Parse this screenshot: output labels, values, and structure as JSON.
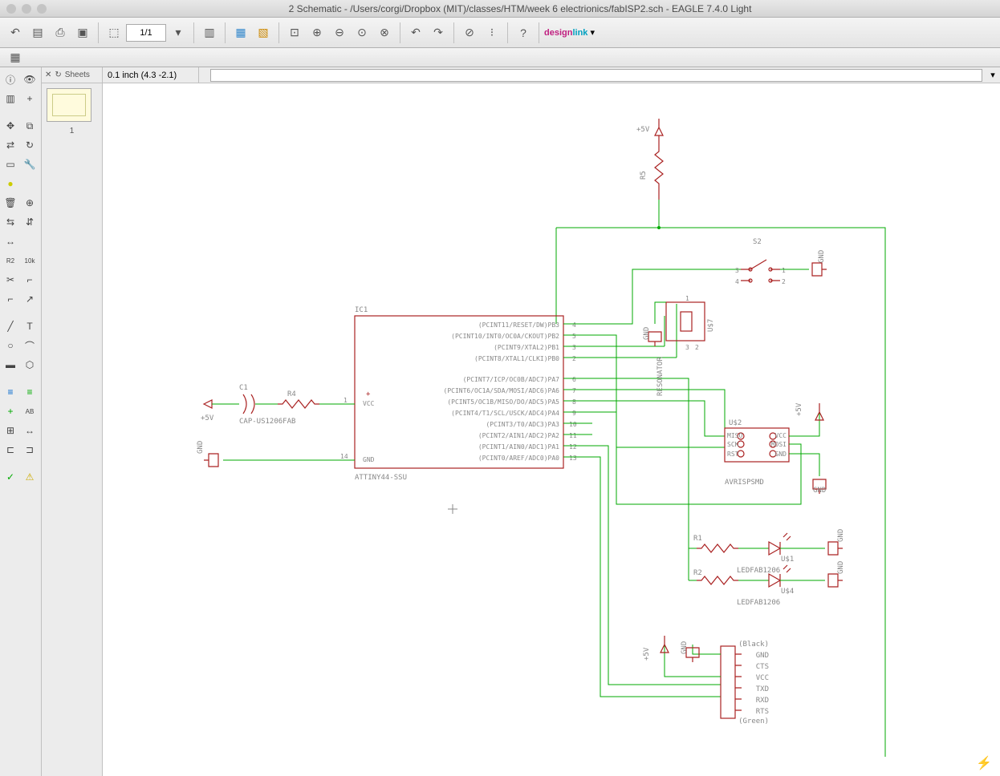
{
  "window": {
    "title": "2 Schematic - /Users/corgi/Dropbox (MIT)/classes/HTM/week 6 electrionics/fabISP2.sch - EAGLE 7.4.0 Light"
  },
  "toolbar": {
    "zoom": "1/1",
    "designlink_a": "design",
    "designlink_b": "link"
  },
  "sheets": {
    "label": "Sheets",
    "current": "1"
  },
  "coord": "0.1 inch (4.3 -2.1)",
  "schematic": {
    "ic1": {
      "ref": "IC1",
      "value": "ATTINY44-SSU",
      "vcc": "VCC",
      "gnd": "GND",
      "pin1": "1",
      "pin14": "14",
      "right_pins": [
        "4",
        "5",
        "3",
        "2",
        "6",
        "7",
        "8",
        "9",
        "10",
        "11",
        "12",
        "13"
      ],
      "right_labels": [
        "(PCINT11/RESET/DW)PB3",
        "(PCINT10/INT0/OC0A/CKOUT)PB2",
        "(PCINT9/XTAL2)PB1",
        "(PCINT8/XTAL1/CLKI)PB0",
        "(PCINT7/ICP/OC0B/ADC7)PA7",
        "(PCINT6/OC1A/SDA/MOSI/ADC6)PA6",
        "(PCINT5/OC1B/MISO/DO/ADC5)PA5",
        "(PCINT4/T1/SCL/USCK/ADC4)PA4",
        "(PCINT3/T0/ADC3)PA3",
        "(PCINT2/AIN1/ADC2)PA2",
        "(PCINT1/AIN0/ADC1)PA1",
        "(PCINT0/AREF/ADC0)PA0"
      ]
    },
    "c1": {
      "ref": "C1",
      "value": "CAP-US1206FAB"
    },
    "r4": {
      "ref": "R4"
    },
    "r5": {
      "ref": "R5"
    },
    "r1": {
      "ref": "R1"
    },
    "r2": {
      "ref": "R2"
    },
    "power": {
      "p5v": "+5V",
      "gnd": "GND"
    },
    "s2": {
      "ref": "S2",
      "p1": "1",
      "p2": "2",
      "p3": "3",
      "p4": "4"
    },
    "resonator": {
      "ref": "U$7",
      "label": "RESONATOR",
      "p1": "1",
      "p2": "2",
      "p3": "3"
    },
    "isp": {
      "ref": "U$2",
      "value": "AVRISPSMD",
      "pins": {
        "miso": "MISO",
        "vcc": "VCC",
        "sck": "SCK",
        "mosi": "MOSI",
        "rst": "RST",
        "gnd": "GND"
      }
    },
    "led1": {
      "ref": "U$1",
      "value": "LEDFAB1206"
    },
    "led2": {
      "ref": "U$4",
      "value": "LEDFAB1206"
    },
    "ftdi": {
      "black": "(Black)",
      "green": "(Green)",
      "labels": [
        "GND",
        "CTS",
        "VCC",
        "TXD",
        "RXD",
        "RTS"
      ]
    }
  }
}
